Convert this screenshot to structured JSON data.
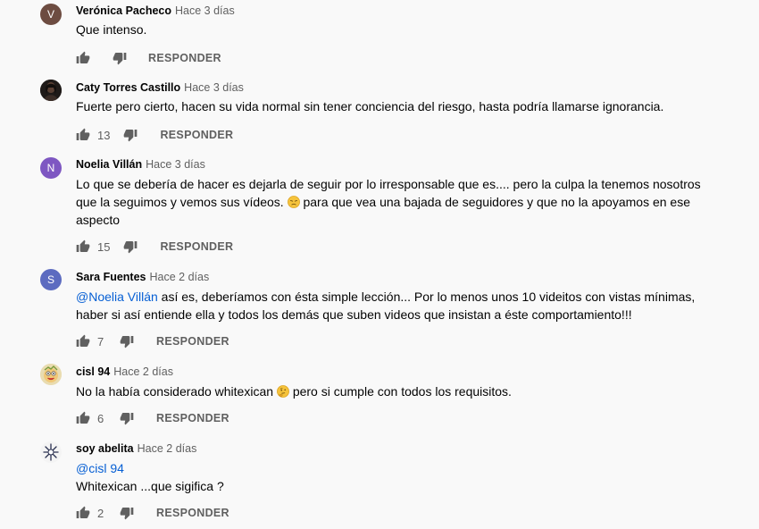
{
  "reply_label": "RESPONDER",
  "comments": [
    {
      "author": "Verónica Pacheco",
      "time": "Hace 3 días",
      "avatar_letter": "V",
      "avatar_color": "#6d4c41",
      "text": "Que intenso.",
      "likes": ""
    },
    {
      "author": "Caty Torres Castillo",
      "time": "Hace 3 días",
      "text": "Fuerte pero cierto, hacen su vida normal sin tener conciencia del riesgo, hasta podría llamarse ignorancia.",
      "likes": "13"
    },
    {
      "author": "Noelia Villán",
      "time": "Hace 3 días",
      "avatar_letter": "N",
      "avatar_color": "#7e57c2",
      "text_part1": "Lo que se debería de hacer es dejarla de seguir por lo irresponsable que es.... pero la culpa la tenemos nosotros que la seguimos y vemos sus vídeos.",
      "text_part2": "para que vea una bajada de seguidores y que no la apoyamos en ese aspecto",
      "emoji": "disappointed-face-icon",
      "likes": "15"
    },
    {
      "author": "Sara Fuentes",
      "time": "Hace 2 días",
      "avatar_letter": "S",
      "avatar_color": "#5c6bc0",
      "mention": "@Noelia Villán",
      "text": "así es, deberíamos con ésta simple lección... Por lo menos unos 10 videitos con vistas mínimas, haber si así entiende ella y todos los demás que suben videos que insistan a éste comportamiento!!!",
      "likes": "7"
    },
    {
      "author": "cisl 94",
      "time": "Hace 2 días",
      "text_part1": "No la había considerado whitexican",
      "text_part2": "pero si cumple con todos los requisitos.",
      "emoji": "thinking-face-icon",
      "likes": "6"
    },
    {
      "author": "soy abelita",
      "time": "Hace 2 días",
      "mention": "@cisl 94",
      "text": "Whitexican ...que sigifica ?",
      "likes": "2"
    }
  ]
}
